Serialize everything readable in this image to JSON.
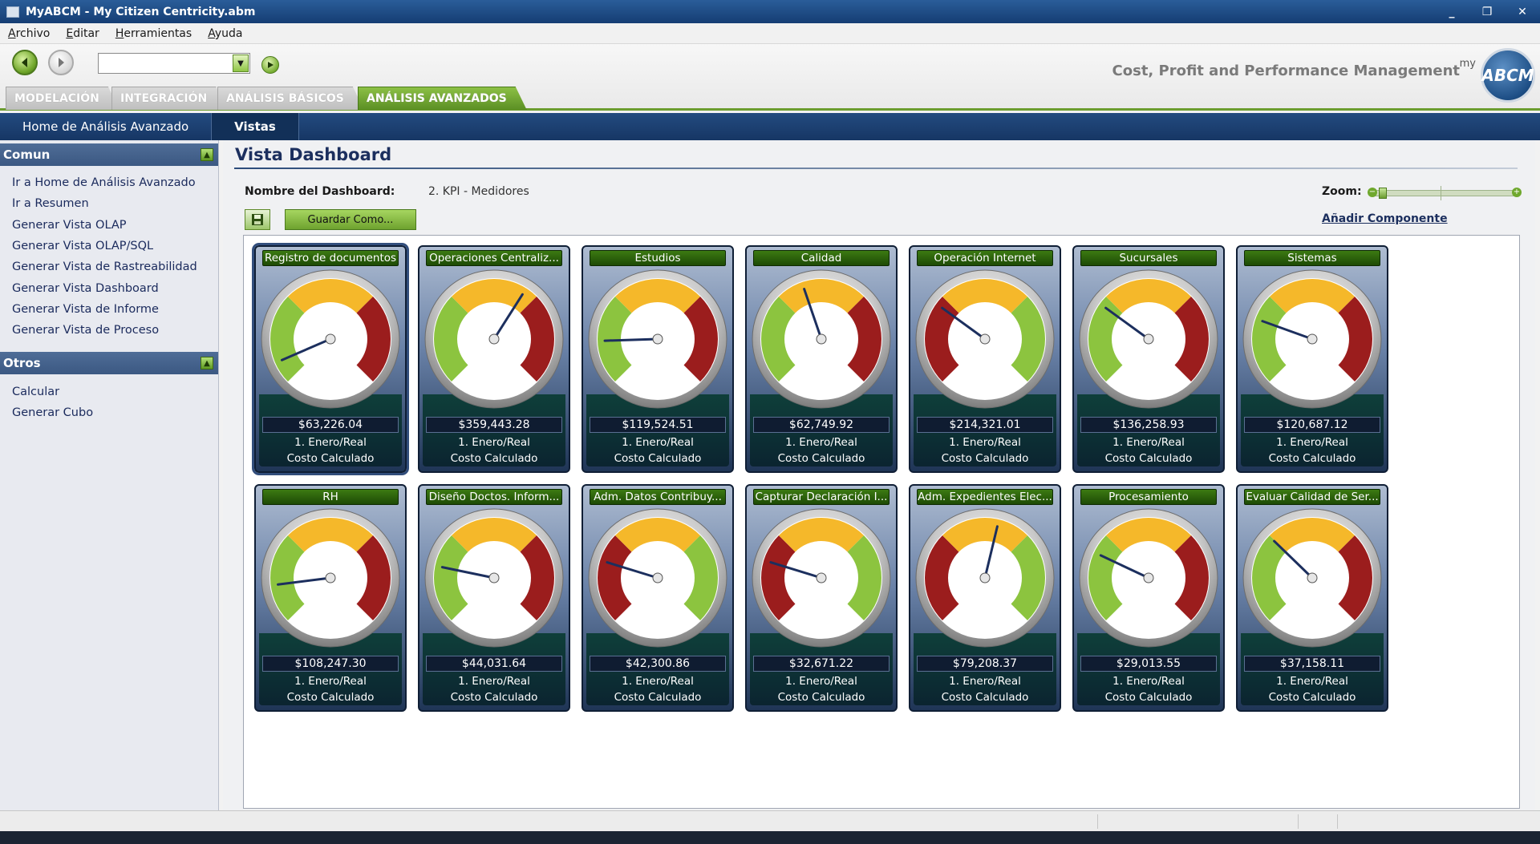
{
  "window": {
    "title": "MyABCM - My Citizen Centricity.abm",
    "minimize": "_",
    "restore": "❐",
    "close": "✕"
  },
  "menu": [
    "Archivo",
    "Editar",
    "Herramientas",
    "Ayuda"
  ],
  "brand": {
    "tagline": "Cost, Profit and Performance Management",
    "logo_my": "my",
    "logo_text": "ABCM"
  },
  "tabs": [
    {
      "label": "MODELACIÓN",
      "active": false
    },
    {
      "label": "INTEGRACIÓN",
      "active": false
    },
    {
      "label": "ANÁLISIS BÁSICOS",
      "active": false
    },
    {
      "label": "ANÁLISIS AVANZADOS",
      "active": true
    }
  ],
  "subnav": [
    {
      "label": "Home de Análisis Avanzado",
      "active": false
    },
    {
      "label": "Vistas",
      "active": true
    }
  ],
  "sidebar": {
    "sections": [
      {
        "title": "Comun",
        "items": [
          "Ir a Home de Análisis Avanzado",
          "Ir a Resumen",
          "Generar Vista OLAP",
          "Generar Vista OLAP/SQL",
          "Generar Vista de Rastreabilidad",
          "Generar Vista Dashboard",
          "Generar Vista de Informe",
          "Generar Vista de Proceso"
        ]
      },
      {
        "title": "Otros",
        "items": [
          "Calcular",
          "Generar Cubo"
        ]
      }
    ]
  },
  "main": {
    "title": "Vista Dashboard",
    "dashboard_label": "Nombre del Dashboard:",
    "dashboard_name": "2. KPI - Medidores",
    "zoom_label": "Zoom:",
    "add_component": "Añadir Componente",
    "save_as": "Guardar Como..."
  },
  "colors": {
    "red": "#9b1d1d",
    "yellow": "#f5b82a",
    "green": "#8cc43f",
    "needle": "#1c2f5e"
  },
  "gauges": [
    {
      "title": "Registro de documentos",
      "value": "$63,226.04",
      "line1": "1. Enero/Real",
      "line2": "Costo Calculado",
      "needle": 0.08,
      "zones": [
        "green",
        "yellow",
        "red"
      ],
      "selected": true
    },
    {
      "title": "Operaciones Centraliz...",
      "value": "$359,443.28",
      "line1": "1. Enero/Real",
      "line2": "Costo Calculado",
      "needle": 0.62,
      "zones": [
        "green",
        "yellow",
        "red"
      ]
    },
    {
      "title": "Estudios",
      "value": "$119,524.51",
      "line1": "1. Enero/Real",
      "line2": "Costo Calculado",
      "needle": 0.16,
      "zones": [
        "green",
        "yellow",
        "red"
      ]
    },
    {
      "title": "Calidad",
      "value": "$62,749.92",
      "line1": "1. Enero/Real",
      "line2": "Costo Calculado",
      "needle": 0.43,
      "zones": [
        "green",
        "yellow",
        "red"
      ]
    },
    {
      "title": "Operación Internet",
      "value": "$214,321.01",
      "line1": "1. Enero/Real",
      "line2": "Costo Calculado",
      "needle": 0.3,
      "zones": [
        "red",
        "yellow",
        "green"
      ]
    },
    {
      "title": "Sucursales",
      "value": "$136,258.93",
      "line1": "1. Enero/Real",
      "line2": "Costo Calculado",
      "needle": 0.3,
      "zones": [
        "green",
        "yellow",
        "red"
      ]
    },
    {
      "title": "Sistemas",
      "value": "$120,687.12",
      "line1": "1. Enero/Real",
      "line2": "Costo Calculado",
      "needle": 0.24,
      "zones": [
        "green",
        "yellow",
        "red"
      ]
    },
    {
      "title": "RH",
      "value": "$108,247.30",
      "line1": "1. Enero/Real",
      "line2": "Costo Calculado",
      "needle": 0.14,
      "zones": [
        "green",
        "yellow",
        "red"
      ]
    },
    {
      "title": "Diseño  Doctos. Inform...",
      "value": "$44,031.64",
      "line1": "1. Enero/Real",
      "line2": "Costo Calculado",
      "needle": 0.21,
      "zones": [
        "green",
        "yellow",
        "red"
      ]
    },
    {
      "title": "Adm. Datos Contribuy...",
      "value": "$42,300.86",
      "line1": "1. Enero/Real",
      "line2": "Costo Calculado",
      "needle": 0.23,
      "zones": [
        "red",
        "yellow",
        "green"
      ]
    },
    {
      "title": "Capturar  Declaración I...",
      "value": "$32,671.22",
      "line1": "1. Enero/Real",
      "line2": "Costo Calculado",
      "needle": 0.23,
      "zones": [
        "red",
        "yellow",
        "green"
      ]
    },
    {
      "title": "Adm.  Expedientes Elec...",
      "value": "$79,208.37",
      "line1": "1. Enero/Real",
      "line2": "Costo Calculado",
      "needle": 0.55,
      "zones": [
        "red",
        "yellow",
        "green"
      ]
    },
    {
      "title": "Procesamiento",
      "value": "$29,013.55",
      "line1": "1. Enero/Real",
      "line2": "Costo Calculado",
      "needle": 0.26,
      "zones": [
        "green",
        "yellow",
        "red"
      ]
    },
    {
      "title": "Evaluar Calidad de Ser...",
      "value": "$37,158.11",
      "line1": "1. Enero/Real",
      "line2": "Costo Calculado",
      "needle": 0.33,
      "zones": [
        "green",
        "yellow",
        "red"
      ]
    }
  ]
}
